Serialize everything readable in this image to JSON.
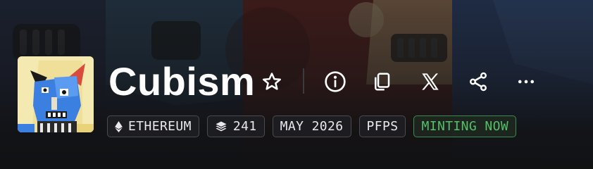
{
  "collection": {
    "name": "Cubism",
    "avatar_icon": "cubist-robot-face-artwork",
    "banner": "cubist-robot-artwork-banner"
  },
  "actions": [
    {
      "name": "favorite",
      "icon": "star-outline-icon"
    },
    {
      "name": "info",
      "icon": "info-circle-icon"
    },
    {
      "name": "copy",
      "icon": "copy-icon"
    },
    {
      "name": "x",
      "icon": "x-logo-icon"
    },
    {
      "name": "share",
      "icon": "share-icon"
    },
    {
      "name": "more",
      "icon": "more-horizontal-icon"
    }
  ],
  "tags": {
    "chain": "ETHEREUM",
    "items": "241",
    "date": "MAY 2026",
    "category": "PFPS",
    "status": "MINTING NOW"
  },
  "colors": {
    "background": "#111214",
    "status_green": "#55c06a",
    "banner_blue": "#2b3a5e",
    "banner_red": "#8b2a22"
  }
}
